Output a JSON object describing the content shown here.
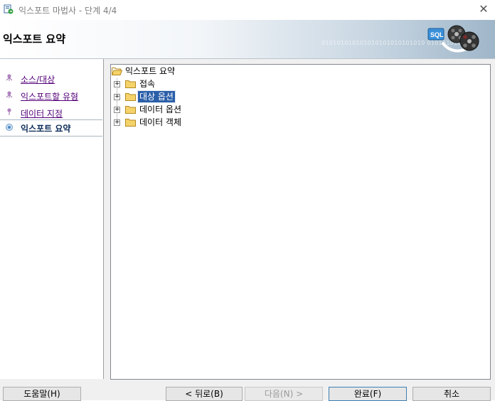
{
  "window": {
    "title": "익스포트 마법사 - 단계 4/4",
    "close_glyph": "✕"
  },
  "banner": {
    "title": "익스포트 요약",
    "binary_text": "010101010101010101010101010 01010101010"
  },
  "steps": [
    {
      "label": "소스/대상",
      "state": "done"
    },
    {
      "label": "익스포트할 유형",
      "state": "done"
    },
    {
      "label": "데이터 지정",
      "state": "done"
    },
    {
      "label": "익스포트 요약",
      "state": "current"
    }
  ],
  "tree": {
    "root": {
      "label": "익스포트 요약",
      "icon": "open-folder-icon"
    },
    "children": [
      {
        "label": "접속",
        "expander": "+",
        "selected": false
      },
      {
        "label": "대상 옵션",
        "expander": "+",
        "selected": true
      },
      {
        "label": "데이터 옵션",
        "expander": "+",
        "selected": false
      },
      {
        "label": "데이터 객체",
        "expander": "+",
        "selected": false
      }
    ]
  },
  "buttons": {
    "help": "도움말(H)",
    "back": "< 뒤로(B)",
    "next": "다음(N) >",
    "finish": "완료(F)",
    "cancel": "취소"
  },
  "colors": {
    "selection": "#2a5ea8",
    "visited_link": "#54007a",
    "current_step": "#0c2b58"
  }
}
